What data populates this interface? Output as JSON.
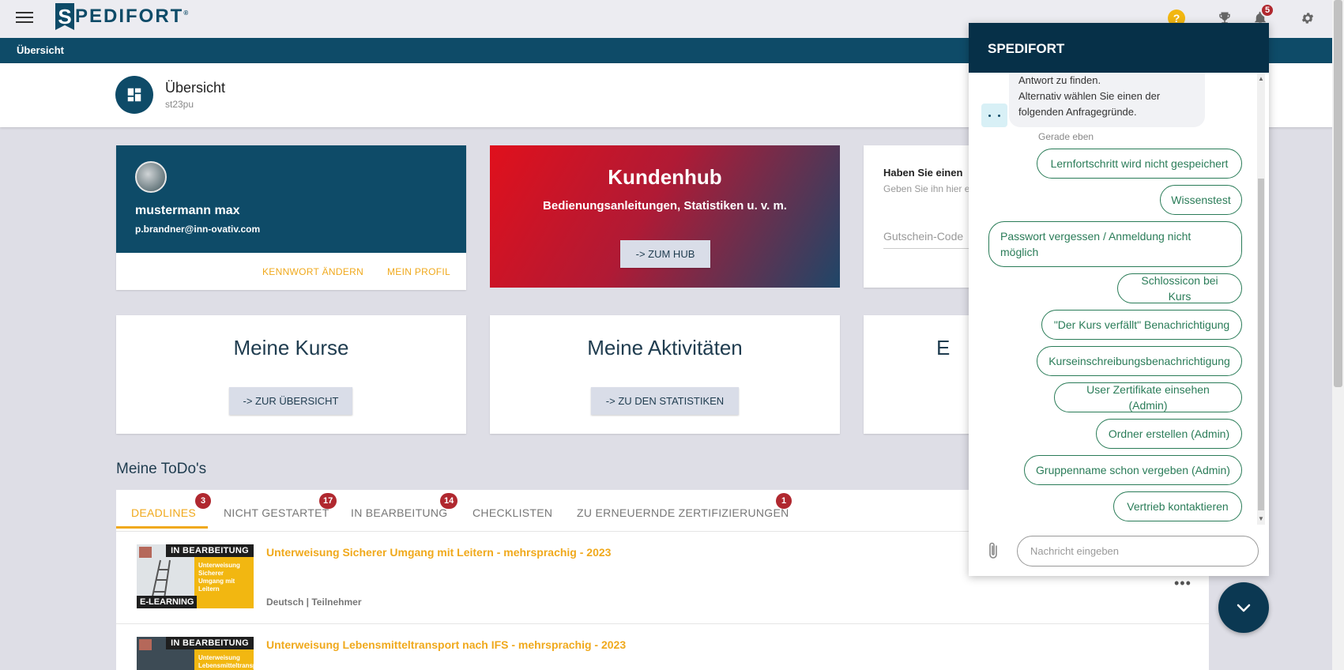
{
  "topbar": {
    "logo_letter": "S",
    "logo_text": "PEDIFORT",
    "logo_reg": "®",
    "help_icon": "question-icon",
    "help_glyph": "?",
    "notifications_count": "5"
  },
  "nav": {
    "breadcrumb": "Übersicht"
  },
  "page_header": {
    "title": "Übersicht",
    "subtitle": "st23pu"
  },
  "profile": {
    "name": "mustermann max",
    "email": "p.brandner@inn-ovativ.com",
    "change_password": "KENNWORT ÄNDERN",
    "my_profile": "MEIN PROFIL"
  },
  "hub": {
    "title": "Kundenhub",
    "subtitle": "Bedienungsanleitungen, Statistiken u. v. m.",
    "button": "-> ZUM HUB"
  },
  "voucher": {
    "title": "Haben Sie einen",
    "subtitle": "Geben Sie ihn hier e",
    "placeholder": "Gutschein-Code"
  },
  "tiles": {
    "courses_title": "Meine Kurse",
    "courses_button": "-> ZUR ÜBERSICHT",
    "activities_title": "Meine Aktivitäten",
    "activities_button": "-> ZU DEN STATISTIKEN",
    "third_title_partial": "E"
  },
  "todos": {
    "title": "Meine ToDo's",
    "tabs": [
      {
        "label": "DEADLINES",
        "badge": "3"
      },
      {
        "label": "NICHT GESTARTET",
        "badge": "17"
      },
      {
        "label": "IN BEARBEITUNG",
        "badge": "14"
      },
      {
        "label": "CHECKLISTEN",
        "badge": ""
      },
      {
        "label": "ZU ERNEUERNDE ZERTIFIZIERUNGEN",
        "badge": "1"
      }
    ],
    "courses": [
      {
        "title": "Unterweisung Sicherer Umgang mit Leitern - mehrsprachig - 2023",
        "meta": "Deutsch | Teilnehmer",
        "status": "IN BEARBEITUNG",
        "type": "E-LEARNING",
        "thumb_text": "Unterweisung Sicherer Umgang mit Leitern"
      },
      {
        "title": "Unterweisung Lebensmitteltransport nach IFS - mehrsprachig - 2023",
        "status": "IN BEARBEITUNG",
        "thumb_text": "Unterweisung Lebensmitteltransport nach IFS"
      }
    ],
    "more_glyph": "•••"
  },
  "chat": {
    "title": "SPEDIFORT",
    "bot_message": [
      "Antwort zu finden.",
      "Alternativ wählen Sie einen der",
      "folgenden Anfragegründe."
    ],
    "timestamp": "Gerade eben",
    "options": [
      "Lernfortschritt wird nicht gespeichert",
      "Wissenstest",
      "Passwort vergessen / Anmeldung nicht möglich",
      "Schlossicon bei Kurs",
      "\"Der Kurs verfällt\" Benachrichtigung",
      "Kurseinschreibungsbenachrichtigung",
      "User Zertifikate einsehen (Admin)",
      "Ordner erstellen (Admin)",
      "Gruppenname schon vergeben (Admin)",
      "Vertrieb kontaktieren"
    ],
    "input_placeholder": "Nachricht eingeben",
    "scroll_up_glyph": "▲",
    "scroll_down_glyph": "▼"
  },
  "colors": {
    "primary": "#0e4b68",
    "accent": "#f0a91c",
    "badge": "#b0282f",
    "chat_chip": "#2a7c58"
  }
}
